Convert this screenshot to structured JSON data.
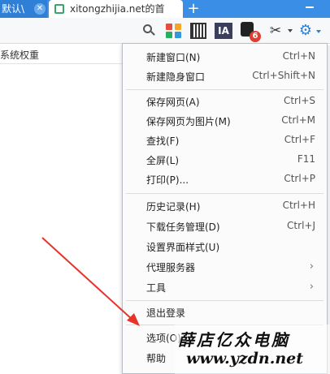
{
  "browser": {
    "tabs": [
      {
        "label": "默认\\",
        "active": true
      },
      {
        "label": "xitongzhijia.net的首",
        "active": false
      }
    ],
    "new_tab_label": "+"
  },
  "toolbar": {
    "ia_label": "IA",
    "extension_badge": "6",
    "icons": [
      "search-icon",
      "apps-icon",
      "qr-code-icon",
      "ia-icon",
      "extension-icon",
      "scissors-icon",
      "gear-icon"
    ]
  },
  "page": {
    "partial_text": "系统权重"
  },
  "menu": {
    "items": [
      {
        "label": "新建窗口(N)",
        "shortcut": "Ctrl+N"
      },
      {
        "label": "新建隐身窗口",
        "shortcut": "Ctrl+Shift+N"
      },
      {
        "label": "保存网页(A)",
        "shortcut": "Ctrl+S"
      },
      {
        "label": "保存网页为图片(M)",
        "shortcut": "Ctrl+M"
      },
      {
        "label": "查找(F)",
        "shortcut": "Ctrl+F"
      },
      {
        "label": "全屏(L)",
        "shortcut": "F11"
      },
      {
        "label": "打印(P)...",
        "shortcut": "Ctrl+P"
      },
      {
        "label": "历史记录(H)",
        "shortcut": "Ctrl+H"
      },
      {
        "label": "下载任务管理(D)",
        "shortcut": "Ctrl+J"
      },
      {
        "label": "设置界面样式(U)",
        "shortcut": ""
      },
      {
        "label": "代理服务器",
        "shortcut": "",
        "submenu": true
      },
      {
        "label": "工具",
        "shortcut": "",
        "submenu": true
      },
      {
        "label": "退出登录",
        "shortcut": ""
      },
      {
        "label": "选项(O)",
        "shortcut": ""
      },
      {
        "label": "帮助",
        "shortcut": ""
      }
    ],
    "submenu_arrow": "›"
  },
  "watermark": {
    "line1": "薛店亿众电脑",
    "line2": "www.yzdn.net"
  },
  "colors": {
    "tab_strip": "#3a8ee6",
    "accent": "#2f7fd6",
    "annotation_arrow": "#e8332a",
    "badge": "#e03c31"
  }
}
